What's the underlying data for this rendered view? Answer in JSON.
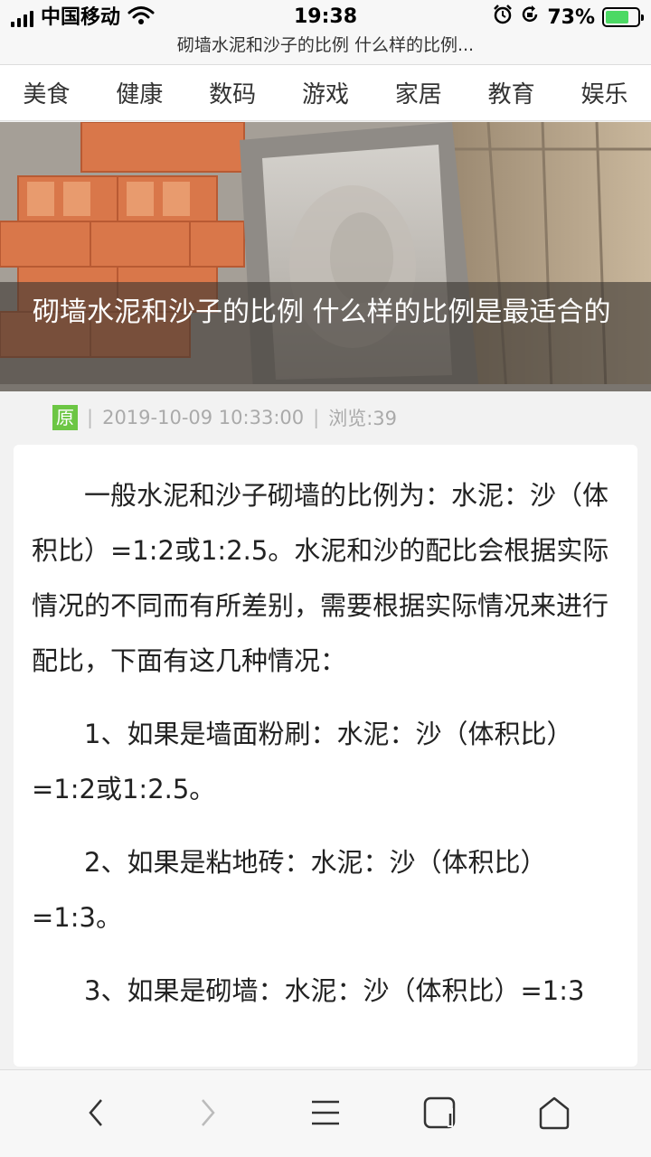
{
  "status_bar": {
    "carrier": "中国移动",
    "time": "19:38",
    "battery_pct": "73%",
    "battery_level": 0.73,
    "icons": [
      "signal-icon",
      "wifi-icon",
      "alarm-icon",
      "rotation-lock-icon",
      "battery-icon"
    ]
  },
  "page_title": "砌墙水泥和沙子的比例 什么样的比例...",
  "categories": [
    "美食",
    "健康",
    "数码",
    "游戏",
    "家居",
    "教育",
    "娱乐"
  ],
  "hero": {
    "title": "砌墙水泥和沙子的比例 什么样的比例是最适合的"
  },
  "meta": {
    "badge": "原",
    "sep": "|",
    "date": "2019-10-09 10:33:00",
    "views": "浏览:39"
  },
  "article": {
    "paragraphs": [
      "一般水泥和沙子砌墙的比例为：水泥：沙（体积比）=1:2或1:2.5。水泥和沙的配比会根据实际情况的不同而有所差别，需要根据实际情况来进行配比，下面有这几种情况：",
      "1、如果是墙面粉刷：水泥：沙（体积比）=1:2或1:2.5。",
      "2、如果是粘地砖：水泥：沙（体积比）=1:3。",
      "3、如果是砌墙：水泥：沙（体积比）=1:3"
    ]
  },
  "bottom_nav": {
    "icons": [
      "back-icon",
      "forward-icon",
      "menu-icon",
      "tabs-icon",
      "home-icon"
    ]
  }
}
